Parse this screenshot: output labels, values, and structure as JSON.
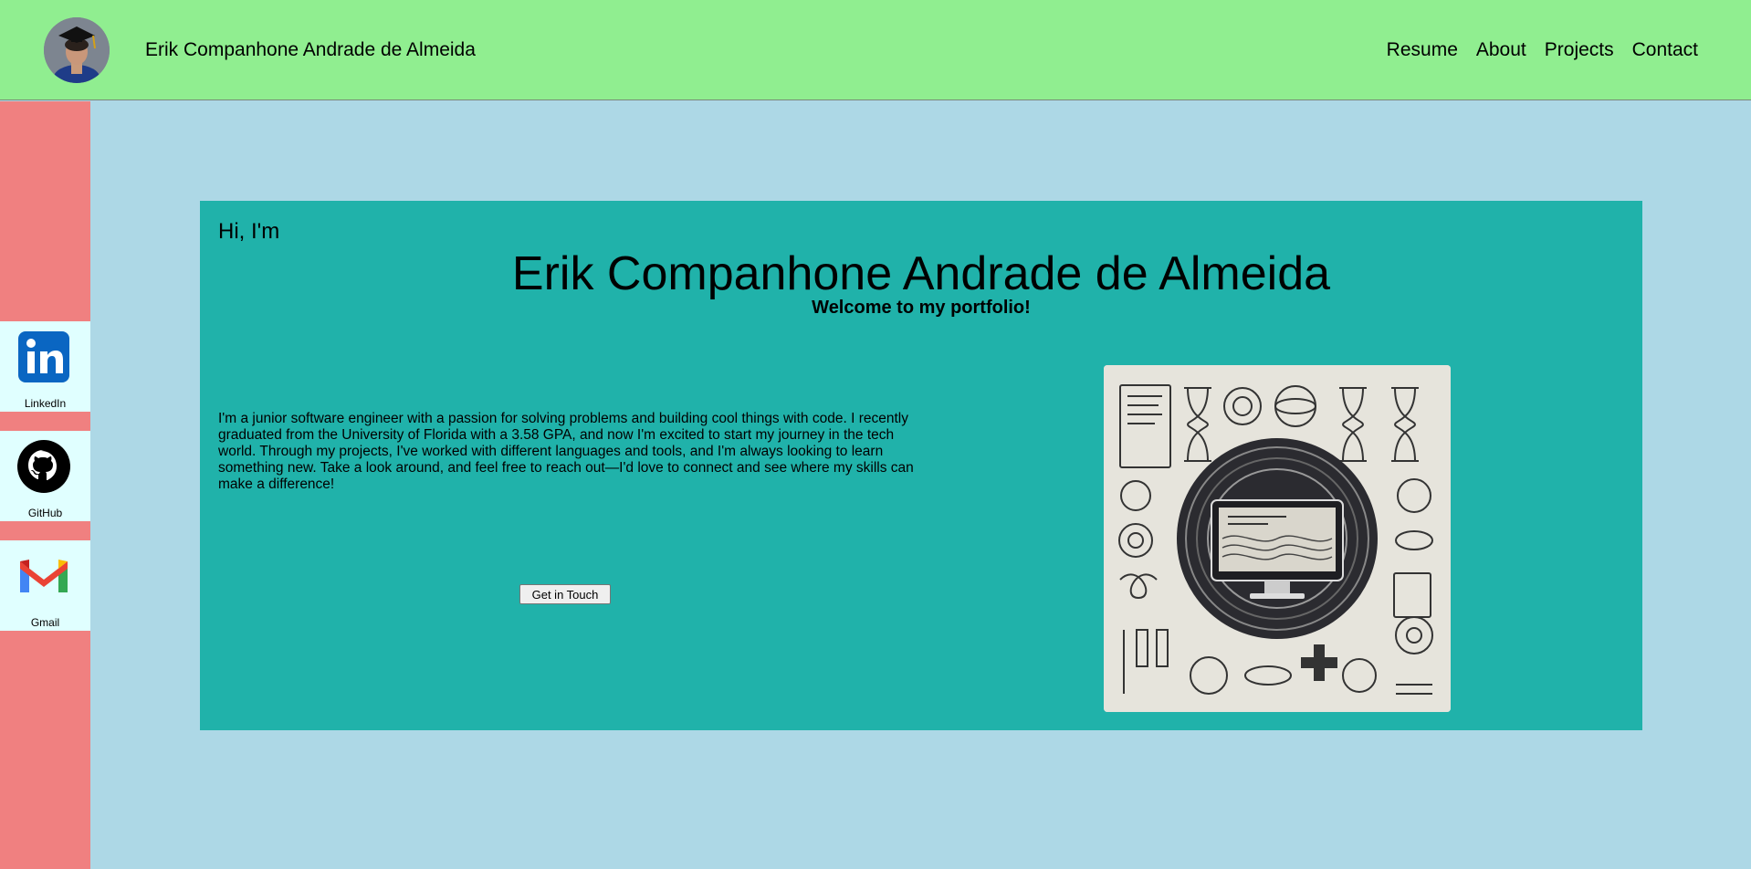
{
  "header": {
    "brand_name": "Erik Companhone Andrade de Almeida",
    "nav": [
      "Resume",
      "About",
      "Projects",
      "Contact"
    ]
  },
  "sidebar": {
    "links": [
      {
        "label": "LinkedIn",
        "icon": "linkedin-icon",
        "color": "#0a66c2"
      },
      {
        "label": "GitHub",
        "icon": "github-icon",
        "color": "#000000"
      },
      {
        "label": "Gmail",
        "icon": "gmail-icon",
        "color": "#ea4335"
      }
    ]
  },
  "hero": {
    "greeting": "Hi, I'm",
    "name": "Erik Companhone Andrade de Almeida",
    "welcome": "Welcome to my portfolio!",
    "bio": "I'm a junior software engineer with a passion for solving problems and building cool things with code. I recently graduated from the University of Florida with a 3.58 GPA, and now I'm excited to start my journey in the tech world. Through my projects, I've worked with different languages and tools, and I'm always looking to learn something new. Take a look around, and feel free to reach out—I'd love to connect and see where my skills can make a difference!",
    "cta_label": "Get in Touch"
  },
  "colors": {
    "header_bg": "#90ee90",
    "sidebar_bg": "#f08080",
    "page_bg": "#add8e6",
    "hero_bg": "#20b2aa",
    "social_tile_bg": "#e0ffff"
  }
}
